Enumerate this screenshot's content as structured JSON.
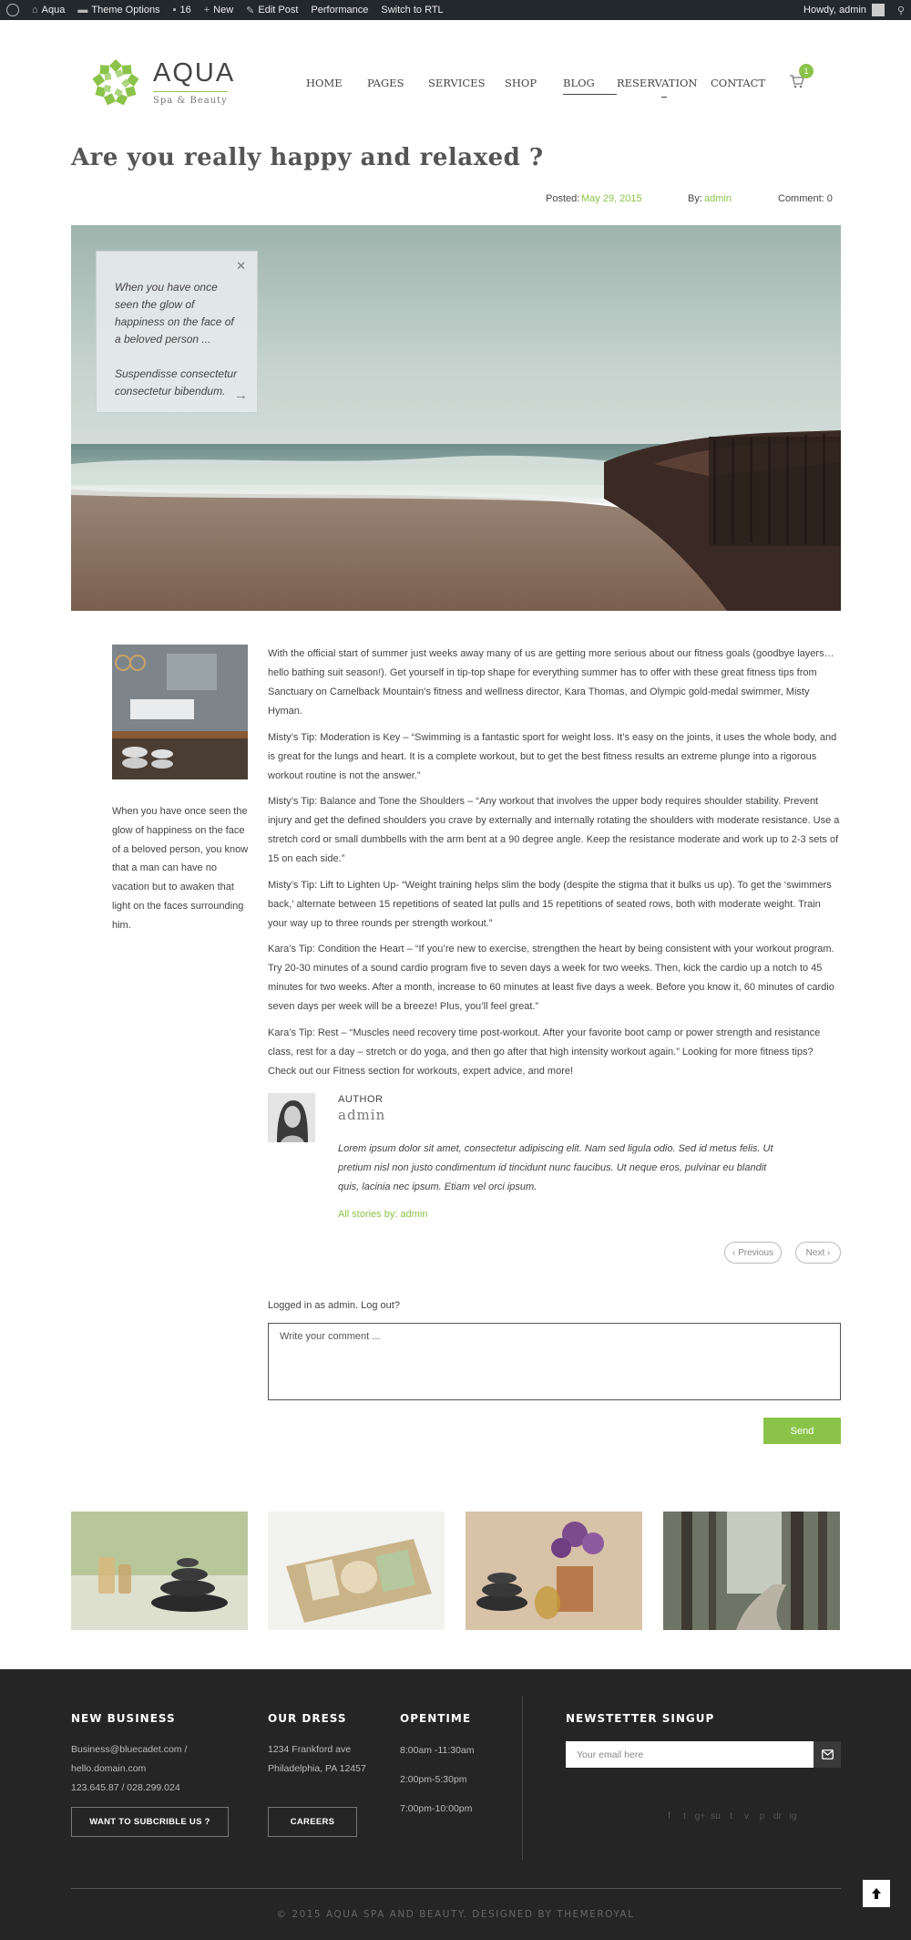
{
  "adminbar": {
    "site_name": "Aqua",
    "theme_options": "Theme Options",
    "comments_count": "16",
    "new_label": "New",
    "edit_post": "Edit Post",
    "performance": "Performance",
    "rtl": "Switch to RTL",
    "howdy": "Howdy, admin"
  },
  "logo": {
    "brand": "AQUA",
    "tagline": "Spa & Beauty",
    "color": "#8bc34a"
  },
  "nav": {
    "items": [
      "HOME",
      "PAGES",
      "SERVICES",
      "SHOP",
      "BLOG",
      "RESERVATION",
      "CONTACT"
    ],
    "active": "BLOG",
    "cart_count": "1"
  },
  "post": {
    "title": "Are you really happy and relaxed ?",
    "posted_label": "Posted:",
    "posted_date": "May 29, 2015",
    "by_label": "By:",
    "by_author": "admin",
    "comment_label": "Comment: 0"
  },
  "hero_quote": {
    "line1": "When you have once seen the glow of happiness on the face of a beloved person ...",
    "line2": "Suspendisse consectetur consectetur bibendum."
  },
  "sidebar_text": "When you have once seen the glow of happiness on the face of a beloved person, you know that a man can have no vacation but to awaken that light on the faces surrounding him.",
  "paragraphs": [
    "With the official start of summer just weeks away many of us are getting more serious about our fitness goals (goodbye layers… hello bathing suit season!). Get yourself in tip-top shape for everything summer has to offer with these great fitness tips from Sanctuary on Camelback Mountain’s fitness and wellness director, Kara Thomas, and Olympic gold-medal swimmer, Misty Hyman.",
    "Misty’s Tip: Moderation is Key – “Swimming is a fantastic sport for weight loss. It’s easy on the joints, it uses the whole body, and is great for the lungs and heart. It is a complete workout, but to get the best fitness results an extreme plunge into a rigorous workout routine is not the answer.”",
    "Misty’s Tip: Balance and Tone the Shoulders – “Any workout that involves the upper body requires shoulder stability. Prevent injury and get the defined shoulders you crave by externally and internally rotating the shoulders with moderate resistance. Use a stretch cord or small dumbbells with the arm bent at a 90 degree angle. Keep the resistance moderate and work up to 2-3 sets of 15 on each side.”",
    "Misty’s Tip: Lift to Lighten Up- “Weight training helps slim the body (despite the stigma that it bulks us up). To get the ‘swimmers back,’ alternate between 15 repetitions of seated lat pulls and 15 repetitions of seated rows, both with moderate weight. Train your way up to three rounds per strength workout.”",
    "Kara’s Tip: Condition the Heart – “If you’re new to exercise, strengthen the heart by being consistent with your workout program. Try 20-30 minutes of a sound cardio program five to seven days a week for two weeks. Then, kick the cardio up a notch to 45 minutes for two weeks. After a month, increase to 60 minutes at least five days a week. Before you know it, 60 minutes of cardio seven days per week will be a breeze! Plus, you’ll feel great.”",
    "Kara’s Tip: Rest – “Muscles need recovery time post-workout. After your favorite boot camp or power strength and resistance class, rest for a day – stretch or do yoga, and then go after that high intensity workout again.” Looking for more fitness tips? Check out our Fitness section for workouts, expert advice, and more!"
  ],
  "author": {
    "label": "AUTHOR",
    "name": "admin",
    "bio": "Lorem ipsum dolor sit amet, consectetur adipiscing elit. Nam sed ligula odio. Sed id metus felis. Ut pretium nisl non justo condimentum id tincidunt nunc faucibus. Ut neque eros, pulvinar eu blandit quis, lacinia nec ipsum. Etiam vel orci ipsum.",
    "stories_link": "All stories by: admin"
  },
  "pager": {
    "prev": "‹  Previous",
    "next": "Next  ›"
  },
  "comment": {
    "logged_in": "Logged in as admin. Log out?",
    "placeholder": "Write your comment ...",
    "send": "Send"
  },
  "footer": {
    "col1": {
      "heading": "NEW BUSINESS",
      "email1": "Business@bluecadet.com /",
      "email2": "hello.domain.com",
      "phone": "123.645.87 / 028.299.024",
      "button": "WANT TO SUBCRIBLE US ?"
    },
    "col2": {
      "heading": "OUR DRESS",
      "addr1": "1234 Frankford ave",
      "addr2": "Philadelphia, PA 12457",
      "button": "CAREERS"
    },
    "col3": {
      "heading": "OPENTIME",
      "t1": "8:00am -11:30am",
      "t2": "2:00pm-5:30pm",
      "t3": "7:00pm-10:00pm"
    },
    "newsletter": {
      "heading": "NEWSTETTER SINGUP",
      "placeholder": "Your email here"
    },
    "socials": [
      "f",
      "t",
      "g+",
      "su",
      "t",
      "v",
      "p",
      "dr",
      "ig"
    ],
    "copyright": "© 2015 AQUA SPA AND BEAUTY. DESIGNED BY THEMEROYAL"
  }
}
